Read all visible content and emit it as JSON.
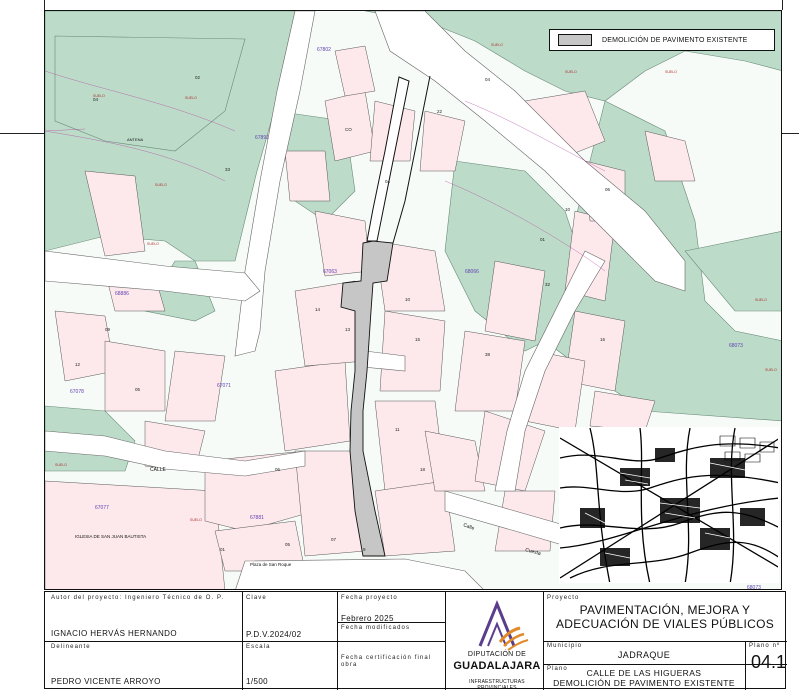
{
  "legend": {
    "demolition_label": "DEMOLICIÓN DE PAVIMENTO EXISTENTE",
    "demolition_color": "#c6c6c6"
  },
  "map": {
    "colors": {
      "green_block": "#bcdcc9",
      "pink_parcel": "#fde9ec",
      "street": "#ffffff",
      "parcel_line": "#555555",
      "parcel_number": "#b03030",
      "block_number": "#6040b0"
    },
    "labels": {
      "church": "IGLESIA DE SAN JUAN BAUTISTA",
      "plaza": "Plaza de San Roque",
      "street_calle": "CALLE",
      "street_cuesta": "Cuesta",
      "street_calle2": "Calle",
      "block_67071": "67071",
      "block_67077": "67077",
      "block_68886": "68886",
      "block_68066": "68066",
      "block_67063": "67063",
      "block_67881": "67881",
      "block_67078": "67078",
      "block_67891": "67891",
      "block_67802": "67802",
      "block_68073": "68073",
      "block_68073b": "68073",
      "antena": "ANTENA"
    }
  },
  "title_block": {
    "author_label": "Autor del proyecto: Ingeniero Técnico de O. P.",
    "author_name": "IGNACIO HERVÁS HERNANDO",
    "delineante_label": "Delineante",
    "delineante_name": "PEDRO VICENTE ARROYO",
    "clave_label": "Clave",
    "clave_value": "P.D.V.2024/02",
    "escala_label": "Escala",
    "escala_value": "1/500",
    "fecha_proyecto_label": "Fecha proyecto",
    "fecha_proyecto_value": "Febrero 2025",
    "fecha_modificados_label": "Fecha modificados",
    "fecha_certificacion_label": "Fecha certificación final obra",
    "logo_line1": "DIPUTACIÓN DE",
    "logo_line2": "GUADALAJARA",
    "logo_line3": "INFRAESTRUCTURAS PROVINCIALES",
    "proyecto_label": "Proyecto",
    "proyecto_title_1": "PAVIMENTACIÓN, MEJORA Y",
    "proyecto_title_2": "ADECUACIÓN DE VIALES PÚBLICOS",
    "municipio_label": "Municipio",
    "municipio_value": "JADRAQUE",
    "plano_label": "Plano",
    "plano_title_1": "CALLE DE LAS HIGUERAS",
    "plano_title_2": "DEMOLICIÓN DE PAVIMENTO EXISTENTE",
    "plano_n_label": "Plano nº",
    "plano_n_value": "04.1",
    "logo_colors": {
      "purple": "#5a3d8c",
      "orange": "#e08a2a"
    }
  }
}
